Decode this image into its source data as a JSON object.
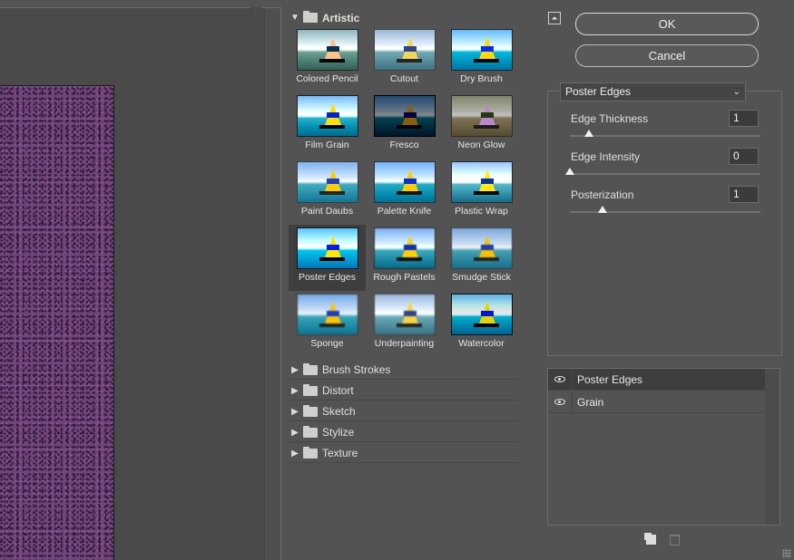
{
  "gallery": {
    "open_category": "Artistic",
    "filters": [
      {
        "label": "Colored Pencil",
        "cls": "t-colored"
      },
      {
        "label": "Cutout",
        "cls": "t-cutout"
      },
      {
        "label": "Dry Brush",
        "cls": "t-dry"
      },
      {
        "label": "Film Grain",
        "cls": "t-grain"
      },
      {
        "label": "Fresco",
        "cls": "t-fresco"
      },
      {
        "label": "Neon Glow",
        "cls": "t-neon"
      },
      {
        "label": "Paint Daubs",
        "cls": "t-paint"
      },
      {
        "label": "Palette Knife",
        "cls": "t-palette"
      },
      {
        "label": "Plastic Wrap",
        "cls": "t-plastic"
      },
      {
        "label": "Poster Edges",
        "cls": "t-poster",
        "selected": true
      },
      {
        "label": "Rough Pastels",
        "cls": "t-rough"
      },
      {
        "label": "Smudge Stick",
        "cls": "t-smudge"
      },
      {
        "label": "Sponge",
        "cls": "t-sponge"
      },
      {
        "label": "Underpainting",
        "cls": "t-under"
      },
      {
        "label": "Watercolor",
        "cls": "t-water"
      }
    ],
    "categories": [
      "Brush Strokes",
      "Distort",
      "Sketch",
      "Stylize",
      "Texture"
    ]
  },
  "buttons": {
    "ok": "OK",
    "cancel": "Cancel"
  },
  "settings": {
    "selected_filter": "Poster Edges",
    "params": [
      {
        "label": "Edge Thickness",
        "value": "1",
        "level": 0.1
      },
      {
        "label": "Edge Intensity",
        "value": "0",
        "level": 0.0
      },
      {
        "label": "Posterization",
        "value": "1",
        "level": 0.17
      }
    ]
  },
  "layers": [
    "Poster Edges",
    "Grain"
  ],
  "colors": {
    "canvas": "#70467a",
    "panel": "#535353",
    "selected": "#3e3e3e"
  },
  "icons": [
    "collapse-icon",
    "folder-icon",
    "eye-icon",
    "new-effect-layer-icon",
    "delete-effect-layer-icon",
    "dropdown-chevron-icon"
  ]
}
